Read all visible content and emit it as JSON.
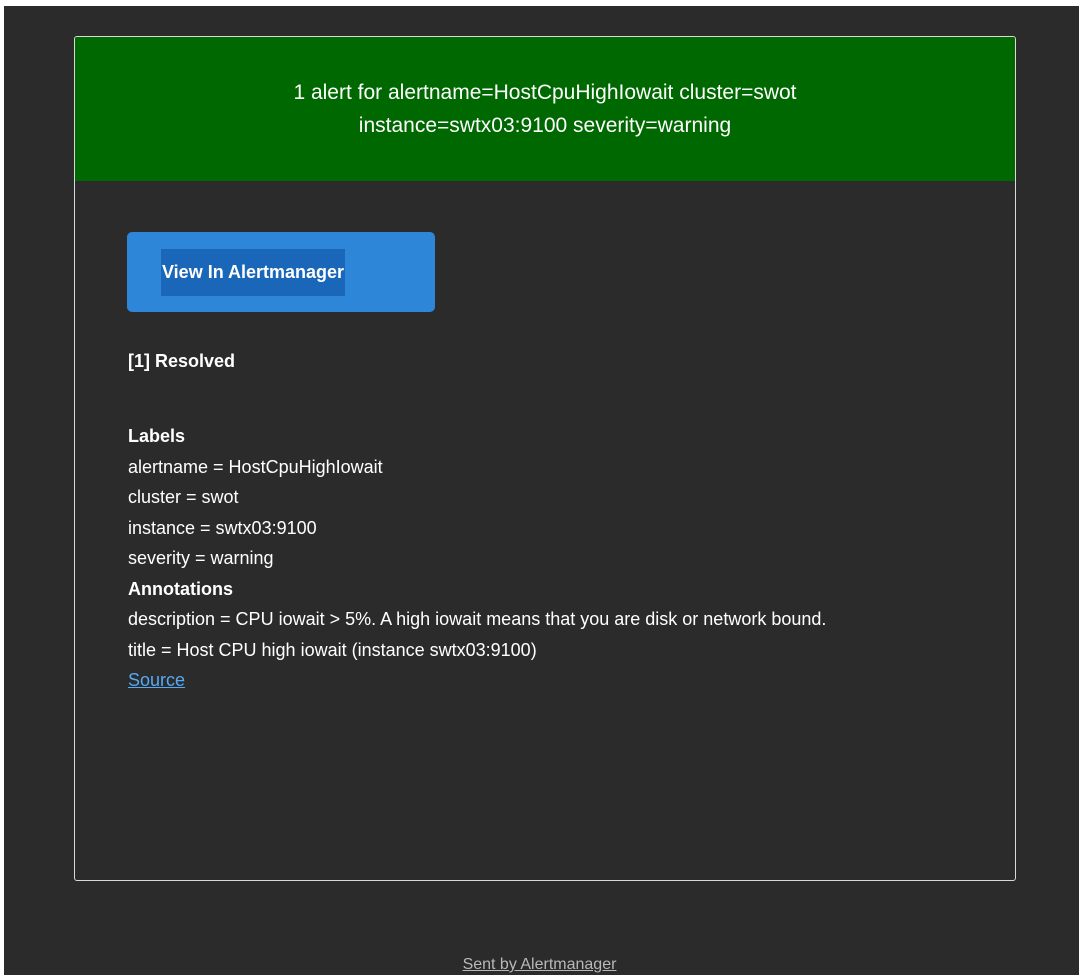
{
  "header": {
    "line1": "1 alert for alertname=HostCpuHighIowait cluster=swot",
    "line2": "instance=swtx03:9100 severity=warning"
  },
  "button": {
    "label": "View In Alertmanager"
  },
  "alert": {
    "heading": "[1] Resolved",
    "labels_title": "Labels",
    "labels": [
      "alertname = HostCpuHighIowait",
      "cluster = swot",
      "instance = swtx03:9100",
      "severity = warning"
    ],
    "annotations_title": "Annotations",
    "annotations": [
      "description = CPU iowait > 5%. A high iowait means that you are disk or network bound.",
      "title = Host CPU high iowait (instance swtx03:9100)"
    ],
    "source_label": "Source"
  },
  "footer": {
    "text": "Sent by Alertmanager"
  },
  "colors": {
    "page_background": "#2b2b2b",
    "header_background": "#006800",
    "button_background": "#2d86d8",
    "button_label_highlight": "#1a66b8",
    "link": "#55a9f5",
    "footer_link": "#b8b8b8"
  }
}
